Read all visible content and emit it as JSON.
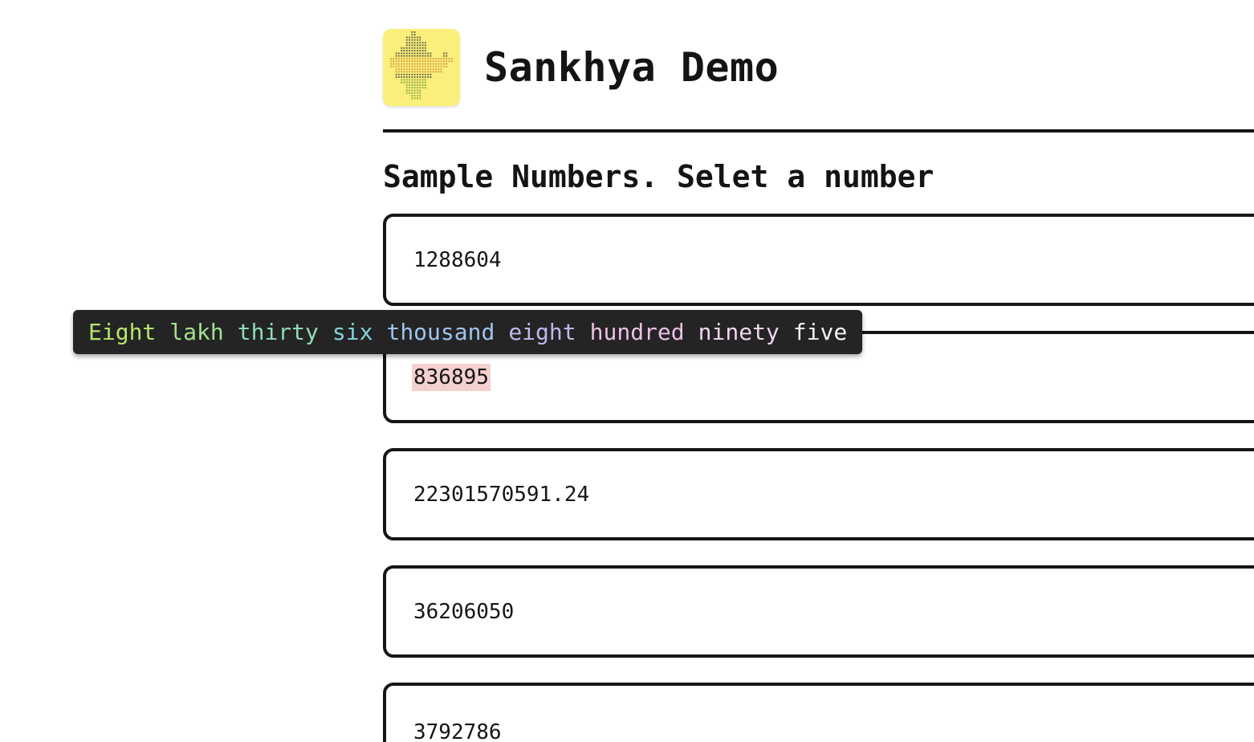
{
  "header": {
    "title": "Sankhya Demo",
    "logo_icon": "india-map-dot-icon"
  },
  "section": {
    "title": "Sample Numbers. Selet a number"
  },
  "numbers": [
    {
      "value": "1288604"
    },
    {
      "value": "836895",
      "selected": true
    },
    {
      "value": "22301570591.24"
    },
    {
      "value": "36206050"
    },
    {
      "value": "3792786"
    }
  ],
  "tooltip": {
    "words": [
      {
        "text": "Eight",
        "color": "#b5e66e"
      },
      {
        "text": "lakh",
        "color": "#a3e08f"
      },
      {
        "text": "thirty",
        "color": "#8fdcb6"
      },
      {
        "text": "six",
        "color": "#83d4dc"
      },
      {
        "text": "thousand",
        "color": "#9fc4ee"
      },
      {
        "text": "eight",
        "color": "#c2b7ee"
      },
      {
        "text": "hundred",
        "color": "#ecc0e6"
      },
      {
        "text": "ninety",
        "color": "#f0d5ee"
      },
      {
        "text": "five",
        "color": "#f4f4f4"
      }
    ]
  },
  "colors": {
    "logo_bg": "#fbef7c",
    "selected_highlight": "#f4d0cf",
    "tooltip_bg": "#242424"
  }
}
